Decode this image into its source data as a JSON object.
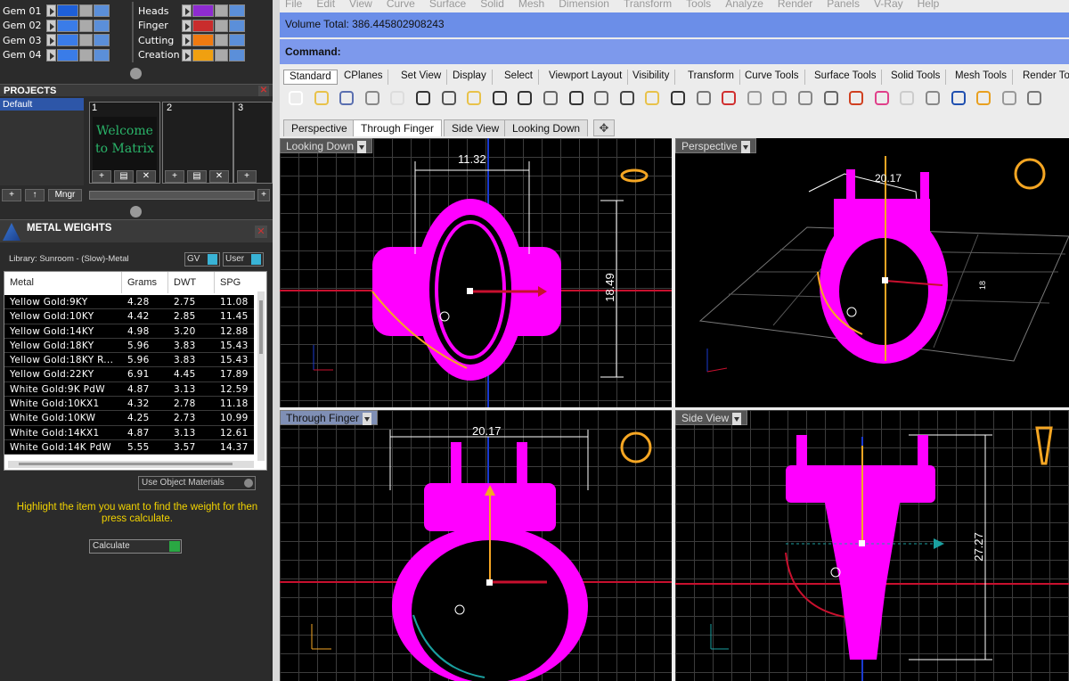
{
  "layers_left": [
    {
      "name": "Gem 01",
      "color": "#1e5fd8"
    },
    {
      "name": "Gem 02",
      "color": "#3a7ce8"
    },
    {
      "name": "Gem 03",
      "color": "#3a7ce8"
    },
    {
      "name": "Gem 04",
      "color": "#3a7ce8"
    }
  ],
  "layers_right": [
    {
      "name": "Heads",
      "color": "#8e2bd0"
    },
    {
      "name": "Finger",
      "color": "#c92c2c"
    },
    {
      "name": "Cutting",
      "color": "#f07a10"
    },
    {
      "name": "Creation",
      "color": "#f0a010"
    }
  ],
  "projects": {
    "title": "PROJECTS",
    "default_item": "Default",
    "slots": [
      "1",
      "2",
      "3"
    ],
    "welcome_text": "Welcome to Matrix",
    "mngr_label": "Mngr"
  },
  "metal_weights": {
    "title": "METAL WEIGHTS",
    "library": "Library: Sunroom - (Slow)-Metal",
    "gv_label": "GV",
    "user_label": "User",
    "columns": [
      "Metal",
      "Grams",
      "DWT",
      "SPG"
    ],
    "rows": [
      [
        "Yellow Gold:9KY",
        "4.28",
        "2.75",
        "11.08"
      ],
      [
        "Yellow Gold:10KY",
        "4.42",
        "2.85",
        "11.45"
      ],
      [
        "Yellow Gold:14KY",
        "4.98",
        "3.20",
        "12.88"
      ],
      [
        "Yellow Gold:18KY",
        "5.96",
        "3.83",
        "15.43"
      ],
      [
        "Yellow Gold:18KY R...",
        "5.96",
        "3.83",
        "15.43"
      ],
      [
        "Yellow Gold:22KY",
        "6.91",
        "4.45",
        "17.89"
      ],
      [
        "White Gold:9K PdW",
        "4.87",
        "3.13",
        "12.59"
      ],
      [
        "White Gold:10KX1",
        "4.32",
        "2.78",
        "11.18"
      ],
      [
        "White Gold:10KW",
        "4.25",
        "2.73",
        "10.99"
      ],
      [
        "White Gold:14KX1",
        "4.87",
        "3.13",
        "12.61"
      ],
      [
        "White Gold:14K PdW",
        "5.55",
        "3.57",
        "14.37"
      ]
    ],
    "use_object_materials": "Use Object Materials",
    "hint": "Highlight the item you want to find the weight for then press calculate.",
    "calculate_label": "Calculate"
  },
  "menu": [
    "File",
    "Edit",
    "View",
    "Curve",
    "Surface",
    "Solid",
    "Mesh",
    "Dimension",
    "Transform",
    "Tools",
    "Analyze",
    "Render",
    "Panels",
    "V-Ray",
    "Help"
  ],
  "command": {
    "history": "Volume Total: 386.445802908243",
    "prompt": "Command:"
  },
  "toolbar_tabs": [
    "Standard",
    "CPlanes",
    "Set View",
    "Display",
    "Select",
    "Viewport Layout",
    "Visibility",
    "Transform",
    "Curve Tools",
    "Surface Tools",
    "Solid Tools",
    "Mesh Tools",
    "Render To"
  ],
  "toolbar_icons": [
    "new-file-icon",
    "open-folder-icon",
    "save-icon",
    "print-icon",
    "import-icon",
    "cut-icon",
    "copy-icon",
    "paste-icon",
    "undo-icon",
    "pan-hand-icon",
    "move-view-icon",
    "zoom-icon",
    "zoom-window-icon",
    "zoom-extents-icon",
    "zoom-selected-icon",
    "rotate-view-icon",
    "four-view-icon",
    "car-icon",
    "camera-icon",
    "circle-icon",
    "display-icon",
    "lock-icon",
    "box-icon",
    "color-wheel-icon",
    "sphere-icon",
    "sphere-wire-icon",
    "sphere-blue-icon",
    "wand-icon",
    "gear-icon",
    "tools-icon"
  ],
  "view_tabs": [
    "Perspective",
    "Through Finger",
    "Side View",
    "Looking Down"
  ],
  "viewports": {
    "looking_down": {
      "label": "Looking Down",
      "dim_h": "11.32",
      "dim_v": "18.49"
    },
    "perspective": {
      "label": "Perspective",
      "dim_h": "20.17",
      "dim_small": "18"
    },
    "through_finger": {
      "label": "Through Finger",
      "dim_h": "20.17"
    },
    "side_view": {
      "label": "Side View",
      "dim_v": "27.27"
    }
  },
  "colors": {
    "magenta": "#ff00ff",
    "red_axis": "#c8102e",
    "teal_axis": "#1aa0a0",
    "orange": "#f5a623",
    "command_blue": "#6b8ee8"
  }
}
